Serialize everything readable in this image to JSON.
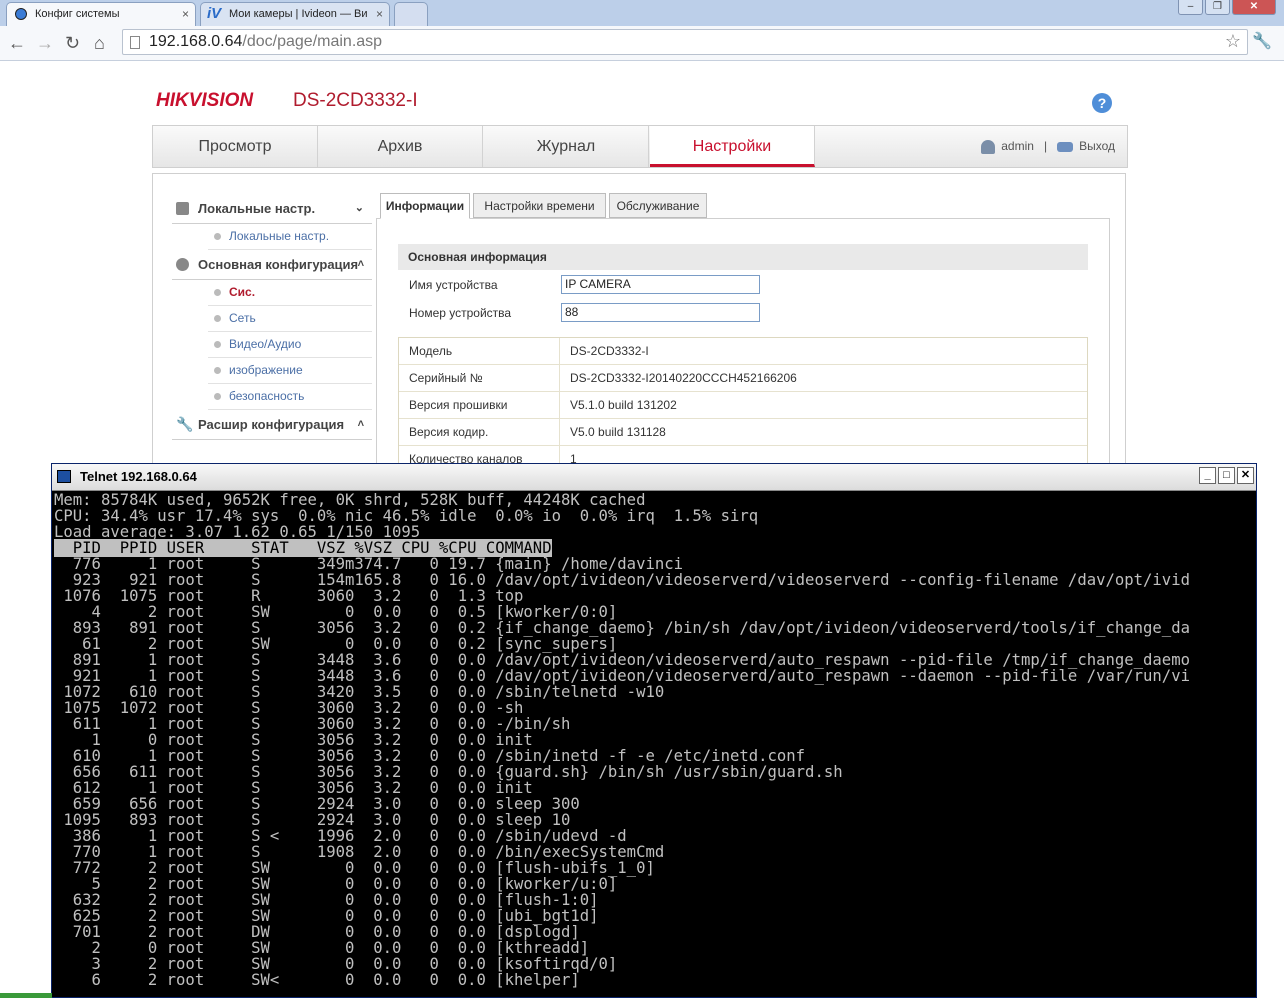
{
  "browser": {
    "tabs": [
      {
        "label": "Конфиг системы",
        "close": "×"
      },
      {
        "label": "Мои камеры | Ivideon — Ви",
        "close": "×",
        "icon": "iV"
      }
    ],
    "url_host": "192.168.0.64",
    "url_path": "/doc/page/main.asp"
  },
  "header": {
    "brand": "HIKVISION",
    "model": "DS-2CD3332-I",
    "help": "?"
  },
  "mainnav": {
    "items": [
      "Просмотр",
      "Архив",
      "Журнал",
      "Настройки"
    ],
    "active": "Настройки",
    "user": "admin",
    "separator": "|",
    "logout": "Выход"
  },
  "sidebar": {
    "groups": [
      {
        "label": "Локальные настр.",
        "chevron": "⌄",
        "items": [
          "Локальные настр."
        ]
      },
      {
        "label": "Основная конфигурация",
        "chevron": "˄",
        "items": [
          "Сис.",
          "Сеть",
          "Видео/Аудио",
          "изображение",
          "безопасность"
        ]
      },
      {
        "label": "Расшир конфигурация",
        "chevron": "˄",
        "items": []
      }
    ],
    "active_item": "Сис."
  },
  "panel": {
    "tabs": [
      "Информации",
      "Настройки времени",
      "Обслуживание"
    ],
    "section_title": "Основная информация",
    "fields": [
      {
        "label": "Имя устройства",
        "value": "IP CAMERA"
      },
      {
        "label": "Номер устройства",
        "value": "88"
      }
    ],
    "info": [
      {
        "key": "Модель",
        "value": "DS-2CD3332-I"
      },
      {
        "key": "Серийный №",
        "value": "DS-2CD3332-I20140220CCCH452166206"
      },
      {
        "key": "Версия прошивки",
        "value": "V5.1.0 build 131202"
      },
      {
        "key": "Версия кодир.",
        "value": "V5.0 build 131128"
      },
      {
        "key": "Количество каналов",
        "value": "1"
      }
    ]
  },
  "telnet": {
    "title": "Telnet 192.168.0.64",
    "summary": [
      "Mem: 85784K used, 9652K free, 0K shrd, 528K buff, 44248K cached",
      "CPU: 34.4% usr 17.4% sys  0.0% nic 46.5% idle  0.0% io  0.0% irq  1.5% sirq",
      "Load average: 3.07 1.62 0.65 1/150 1095"
    ],
    "header": "  PID  PPID USER     STAT   VSZ %VSZ CPU %CPU COMMAND",
    "rows": [
      "  776     1 root     S      349m374.7   0 19.7 {main} /home/davinci",
      "  923   921 root     S      154m165.8   0 16.0 /dav/opt/ivideon/videoserverd/videoserverd --config-filename /dav/opt/ivid",
      " 1076  1075 root     R      3060  3.2   0  1.3 top",
      "    4     2 root     SW        0  0.0   0  0.5 [kworker/0:0]",
      "  893   891 root     S      3056  3.2   0  0.2 {if_change_daemo} /bin/sh /dav/opt/ivideon/videoserverd/tools/if_change_da",
      "   61     2 root     SW        0  0.0   0  0.2 [sync_supers]",
      "  891     1 root     S      3448  3.6   0  0.0 /dav/opt/ivideon/videoserverd/auto_respawn --pid-file /tmp/if_change_daemo",
      "  921     1 root     S      3448  3.6   0  0.0 /dav/opt/ivideon/videoserverd/auto_respawn --daemon --pid-file /var/run/vi",
      " 1072   610 root     S      3420  3.5   0  0.0 /sbin/telnetd -w10",
      " 1075  1072 root     S      3060  3.2   0  0.0 -sh",
      "  611     1 root     S      3060  3.2   0  0.0 -/bin/sh",
      "    1     0 root     S      3056  3.2   0  0.0 init",
      "  610     1 root     S      3056  3.2   0  0.0 /sbin/inetd -f -e /etc/inetd.conf",
      "  656   611 root     S      3056  3.2   0  0.0 {guard.sh} /bin/sh /usr/sbin/guard.sh",
      "  612     1 root     S      3056  3.2   0  0.0 init",
      "  659   656 root     S      2924  3.0   0  0.0 sleep 300",
      " 1095   893 root     S      2924  3.0   0  0.0 sleep 10",
      "  386     1 root     S <    1996  2.0   0  0.0 /sbin/udevd -d",
      "  770     1 root     S      1908  2.0   0  0.0 /bin/execSystemCmd",
      "  772     2 root     SW        0  0.0   0  0.0 [flush-ubifs_1_0]",
      "    5     2 root     SW        0  0.0   0  0.0 [kworker/u:0]",
      "  632     2 root     SW        0  0.0   0  0.0 [flush-1:0]",
      "  625     2 root     SW        0  0.0   0  0.0 [ubi_bgt1d]",
      "  701     2 root     DW        0  0.0   0  0.0 [dsplogd]",
      "    2     0 root     SW        0  0.0   0  0.0 [kthreadd]",
      "    3     2 root     SW        0  0.0   0  0.0 [ksoftirqd/0]",
      "    6     2 root     SW<       0  0.0   0  0.0 [khelper]"
    ]
  }
}
